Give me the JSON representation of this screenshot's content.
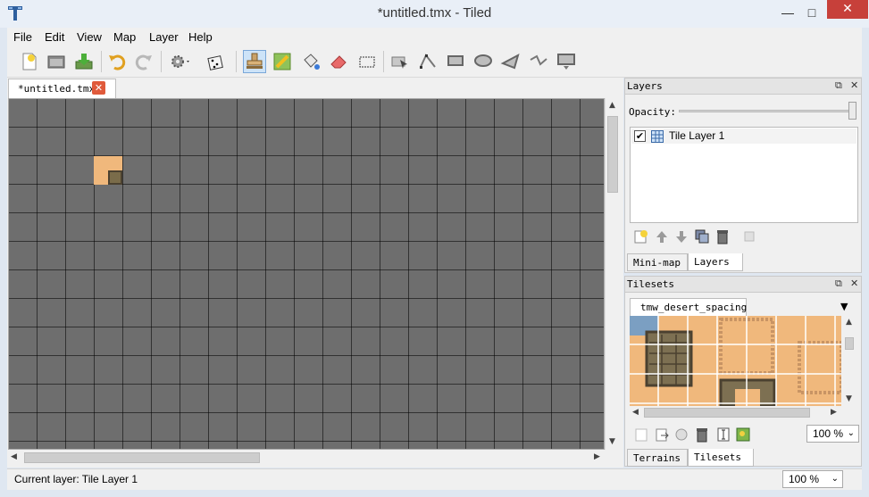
{
  "window": {
    "title": "*untitled.tmx - Tiled",
    "minimize": "—",
    "maximize": "□",
    "close": "✕"
  },
  "menu": [
    "File",
    "Edit",
    "View",
    "Map",
    "Layer",
    "Help"
  ],
  "toolbar": {
    "icons": [
      "new-icon",
      "open-icon",
      "save-icon",
      "undo-icon",
      "redo-icon",
      "commands-icon",
      "random-icon",
      "stamp-brush-icon",
      "terrain-brush-icon",
      "bucket-fill-icon",
      "eraser-icon",
      "rect-select-icon",
      "select-objects-icon",
      "edit-polygons-icon",
      "insert-rectangle-icon",
      "insert-ellipse-icon",
      "insert-polygon-icon",
      "insert-polyline-icon",
      "insert-tile-icon"
    ],
    "active_tool": "stamp-brush-icon"
  },
  "document": {
    "tab_label": "*untitled.tmx",
    "tab_close": "✕"
  },
  "map": {
    "grid_color": "#000000",
    "background": "#6e6e6e"
  },
  "status": {
    "current_layer": "Current layer: Tile Layer 1",
    "zoom": "100 %"
  },
  "layers_dock": {
    "title": "Layers",
    "opacity_label": "Opacity:",
    "opacity_value": 1.0,
    "layers": [
      {
        "name": "Tile Layer 1",
        "visible": true
      }
    ],
    "tabs": [
      "Mini-map",
      "Layers"
    ],
    "active_tab": "Layers"
  },
  "tilesets_dock": {
    "title": "Tilesets",
    "tileset_tab": "tmw_desert_spacing",
    "zoom": "100 %",
    "tabs": [
      "Terrains",
      "Tilesets"
    ],
    "active_tab": "Tilesets"
  },
  "colors": {
    "accent": "#cde3f8",
    "close_red": "#c7403a",
    "sand": "#f0b87c"
  }
}
